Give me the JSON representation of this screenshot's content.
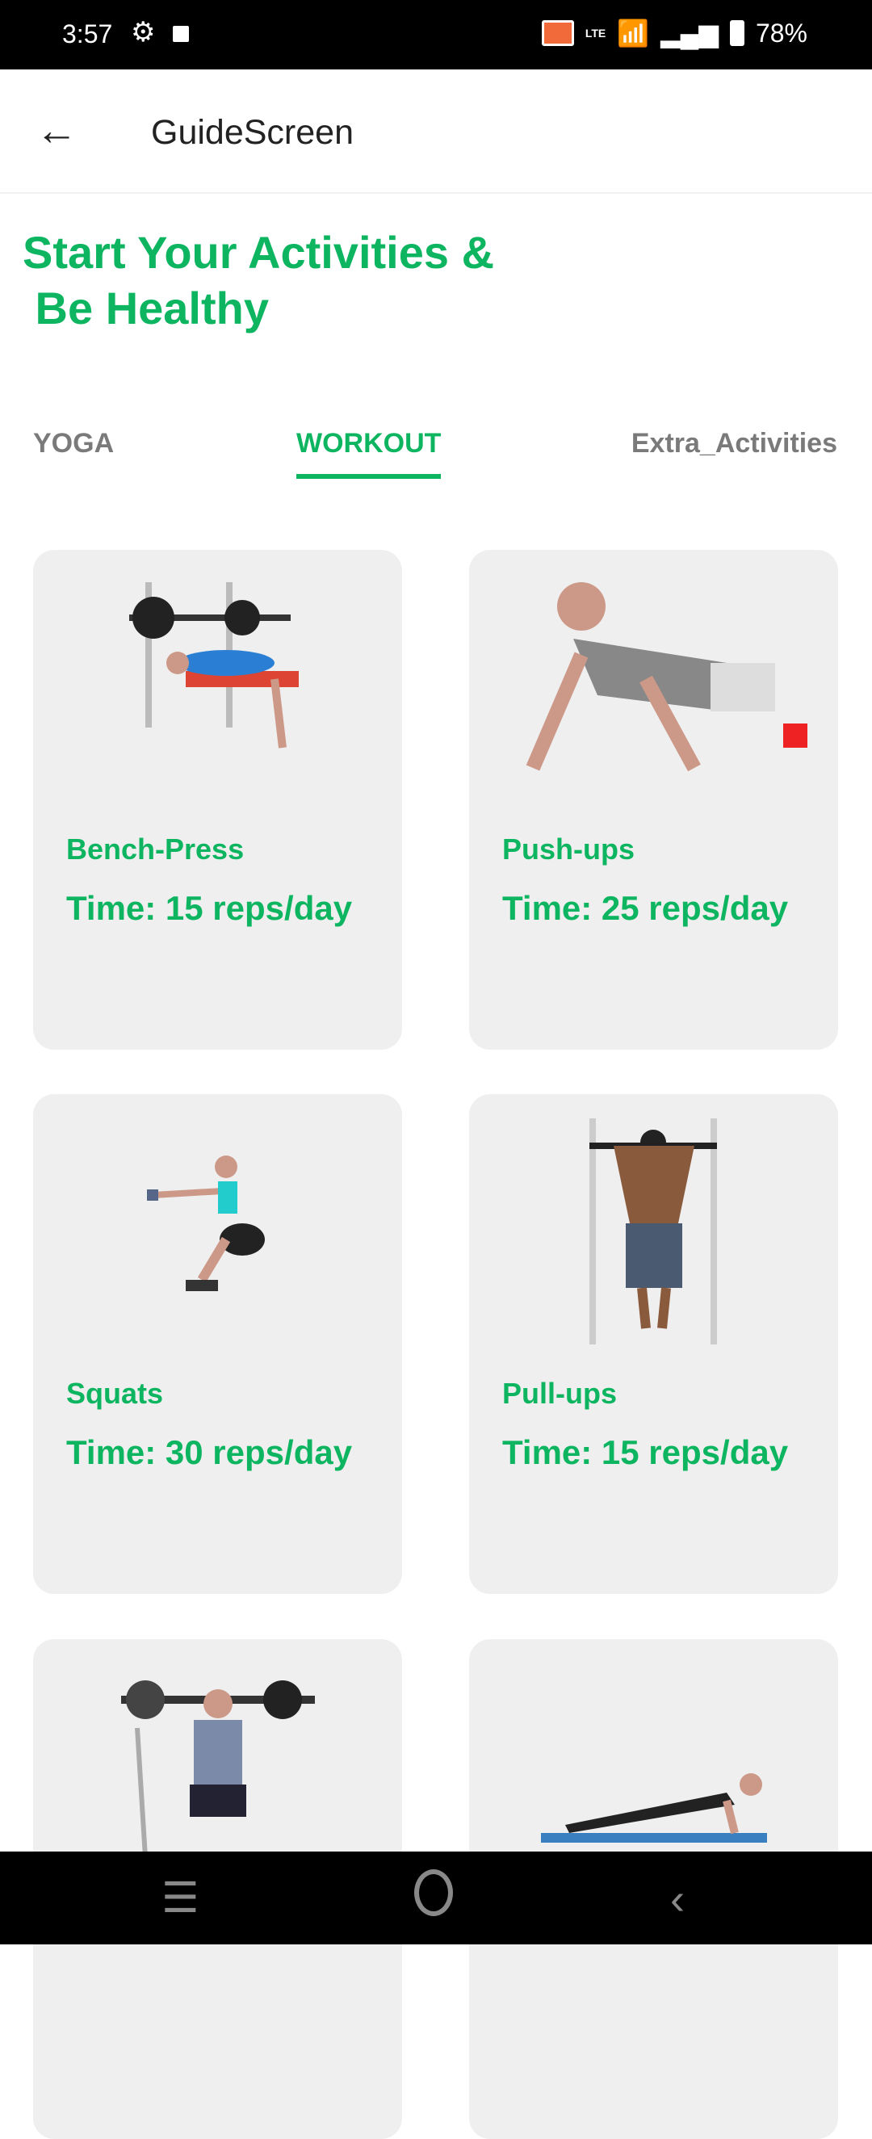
{
  "status_bar": {
    "time": "3:57",
    "battery": "78%",
    "network": "LTE"
  },
  "app_bar": {
    "title": "GuideScreen"
  },
  "heading": "Start Your Activities &\n Be Healthy",
  "tabs": [
    {
      "label": "YOGA"
    },
    {
      "label": "WORKOUT",
      "active": true
    },
    {
      "label": "Extra_Activities"
    }
  ],
  "cards": [
    {
      "name": "Bench-Press",
      "time": "Time: 15 reps/day"
    },
    {
      "name": "Push-ups",
      "time": "Time: 25 reps/day"
    },
    {
      "name": "Squats",
      "time": "Time: 30 reps/day"
    },
    {
      "name": "Pull-ups",
      "time": "Time: 15 reps/day"
    },
    {
      "name": "",
      "time": ""
    },
    {
      "name": "",
      "time": ""
    }
  ],
  "colors": {
    "accent": "#0db561",
    "card": "#efefef"
  }
}
